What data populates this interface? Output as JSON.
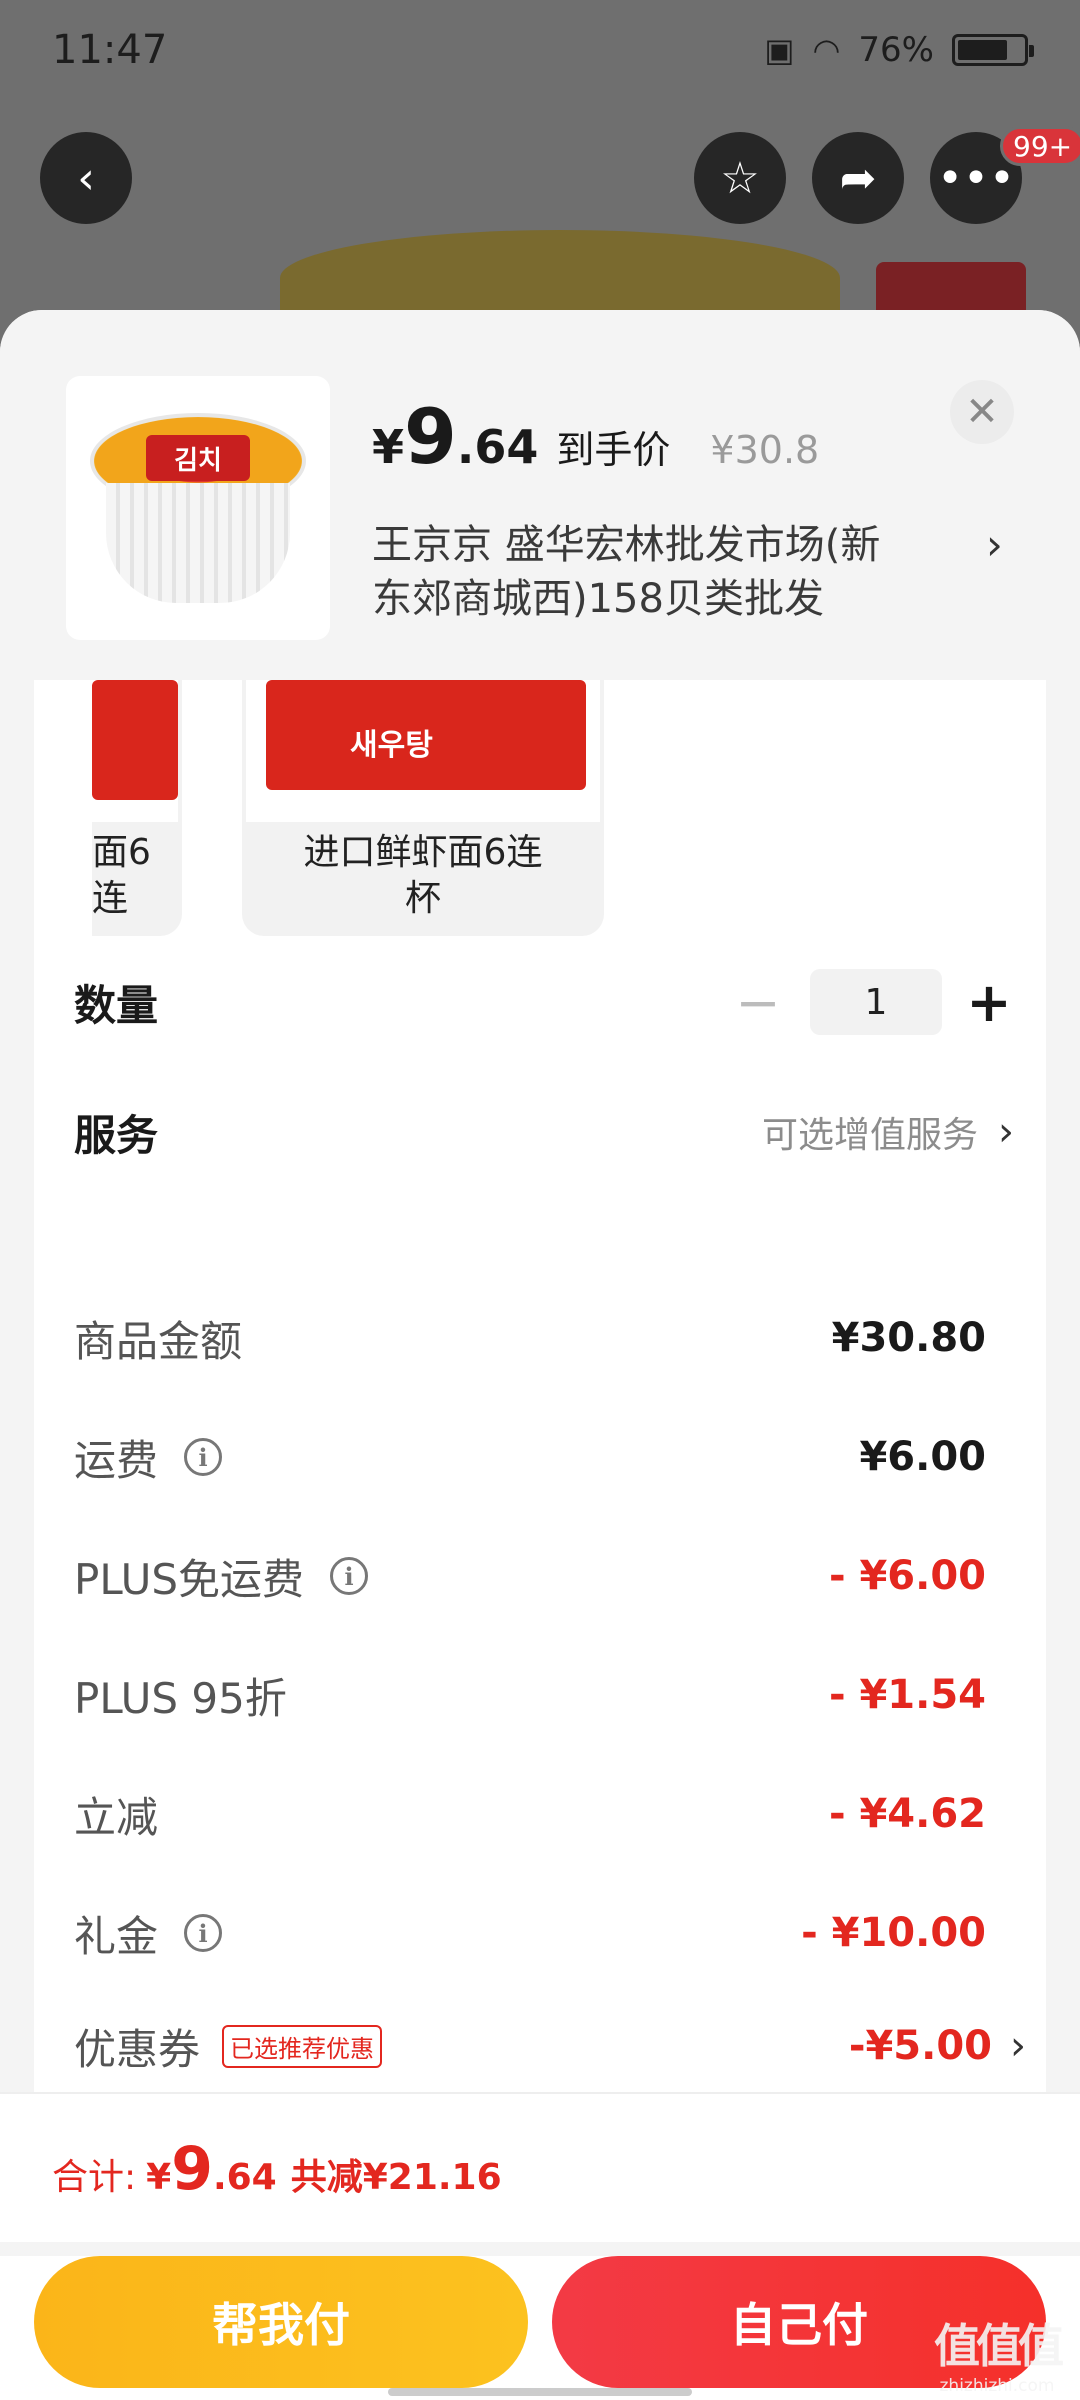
{
  "status_bar": {
    "time": "11:47",
    "battery": "76%",
    "battery_level": 0.76
  },
  "top_bar": {
    "badge": "99+"
  },
  "sheet": {
    "price": {
      "currency": "¥",
      "integer": "9",
      "decimal": ".64",
      "tag": "到手价",
      "original": "¥30.8"
    },
    "shop_line1": "王京京  盛华宏林批发市场(新",
    "shop_line2": "东郊商城西)158贝类批发",
    "variants": [
      {
        "label_line1": "面6连",
        "label_line2": "",
        "img_text": ""
      },
      {
        "label_line1": "进口鲜虾面6连",
        "label_line2": "杯",
        "img_text": "새우탕"
      }
    ],
    "quantity": {
      "label": "数量",
      "value": "1",
      "minus": "−",
      "plus": "+"
    },
    "service": {
      "label": "服务",
      "value": "可选增值服务"
    }
  },
  "breakdown": {
    "goods": {
      "label": "商品金额",
      "value": "¥30.80"
    },
    "shipping": {
      "label": "运费",
      "value": "¥6.00"
    },
    "plus_free_shipping": {
      "label": "PLUS免运费",
      "value": "- ¥6.00"
    },
    "plus_discount": {
      "label": "PLUS 95折",
      "value": "- ¥1.54"
    },
    "instant_off": {
      "label": "立减",
      "value": "- ¥4.62"
    },
    "gift_money": {
      "label": "礼金",
      "value": "- ¥10.00"
    },
    "coupon": {
      "label": "优惠券",
      "tag": "已选推荐优惠",
      "value": "-¥5.00"
    }
  },
  "footer": {
    "total_label": "合计:",
    "total_currency": "¥",
    "total_integer": "9",
    "total_decimal": ".64",
    "total_saved": "共减¥21.16",
    "help_pay": "帮我付",
    "self_pay": "自己付"
  },
  "watermark": {
    "main": "值值值",
    "sub": "zhizhizhi.com"
  },
  "colors": {
    "accent_red": "#e3271f",
    "help_pay_yellow": "#fcb91d",
    "self_pay_red": "#f3343a"
  }
}
